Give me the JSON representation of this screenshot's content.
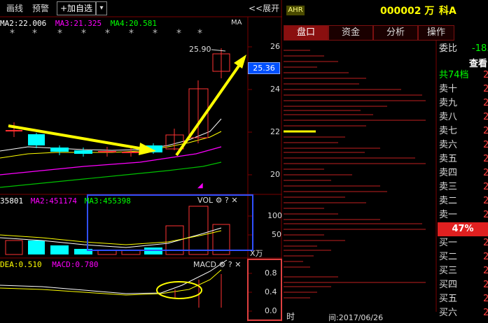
{
  "toolbar": {
    "draw_line": "画线",
    "alert": "预警",
    "add_watchlist": "+加自选",
    "dropdown": "▾",
    "expand": "<<展开"
  },
  "stock": {
    "tag": "AHR",
    "code": "000002 万",
    "name": "科A"
  },
  "tabs": [
    "盘口",
    "资金",
    "分析",
    "操作"
  ],
  "main_chart": {
    "ma2": "MA2:22.006",
    "ma3": "MA3:21.325",
    "ma4": "MA4:20.581",
    "ma_label": "MA",
    "peak_label": "25.90",
    "y_ticks": [
      "26",
      "24",
      "22",
      "20"
    ],
    "current_price": "25.36"
  },
  "vol_chart": {
    "ma1": "35801",
    "ma2": "MA2:451174",
    "ma3": "MA3:455398",
    "title": "VOL",
    "y_ticks": [
      "100",
      "50"
    ],
    "unit": "X万"
  },
  "macd_chart": {
    "dea": "DEA:0.510",
    "macd": "MACD:0.780",
    "title": "MACD",
    "y_ticks": [
      "0.8",
      "0.4",
      "0.0"
    ]
  },
  "orderbook": {
    "ratio_label": "委比",
    "ratio_value": "-18.",
    "view": "查看",
    "total": "共74档",
    "total_val": "2",
    "sells": [
      {
        "label": "卖十",
        "val": "2"
      },
      {
        "label": "卖九",
        "val": "2"
      },
      {
        "label": "卖八",
        "val": "2"
      },
      {
        "label": "卖七",
        "val": "2"
      },
      {
        "label": "卖六",
        "val": "2"
      },
      {
        "label": "卖五",
        "val": "2"
      },
      {
        "label": "卖四",
        "val": "2"
      },
      {
        "label": "卖三",
        "val": "2"
      },
      {
        "label": "卖二",
        "val": "2"
      },
      {
        "label": "卖一",
        "val": "2"
      }
    ],
    "mid_percent": "47%",
    "buys": [
      {
        "label": "买一",
        "val": "2"
      },
      {
        "label": "买二",
        "val": "2"
      },
      {
        "label": "买三",
        "val": "2"
      },
      {
        "label": "买四",
        "val": "2"
      },
      {
        "label": "买五",
        "val": "2"
      },
      {
        "label": "买六",
        "val": "2"
      }
    ]
  },
  "time_bar": {
    "label": "时",
    "label2": "间:2017/06/26"
  },
  "colors": {
    "up": "#ff3232",
    "down": "#00ffff",
    "ma_white": "#ffffff",
    "ma_yellow": "#ffff00",
    "ma_magenta": "#ff00ff",
    "ma_green": "#00c000",
    "annotation_yellow": "#ffff00",
    "annotation_blue": "#3050ff",
    "highlight": "#0050ff"
  }
}
